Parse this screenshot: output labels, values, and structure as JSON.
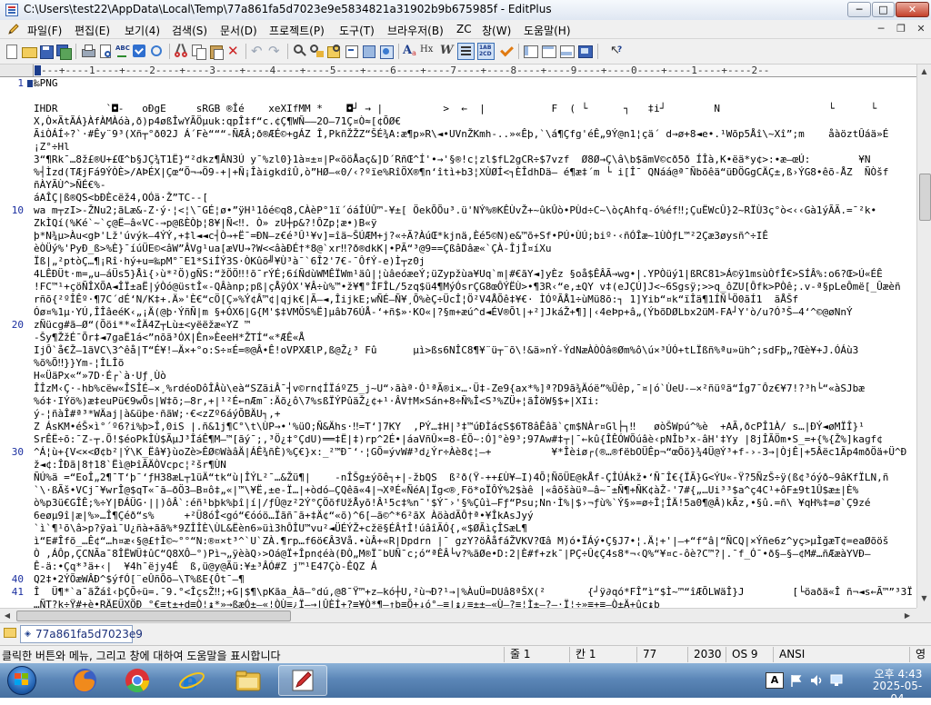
{
  "window": {
    "title": "C:\\Users\\test22\\AppData\\Local\\Temp\\77a861fa5d7023e9e5834821a31902b9b675985f - EditPlus",
    "min_label": "─",
    "max_label": "□",
    "close_label": "✕"
  },
  "menu": {
    "items": [
      "파일(F)",
      "편집(E)",
      "보기(4)",
      "검색(S)",
      "문서(D)",
      "프로젝트(P)",
      "도구(T)",
      "브라우저(B)",
      "ZC",
      "창(W)",
      "도움말(H)"
    ],
    "mdi_min": "─",
    "mdi_restore": "❐",
    "mdi_close": "✕"
  },
  "ruler": {
    "text": "---+----1----+----2----+----3----+----4----+----5----+----6----+----7----+----8----+----9----+----0----+----1----+----2--"
  },
  "editor": {
    "lines": [
      {
        "num": "1",
        "text": "‰PNG"
      },
      {
        "num": "",
        "text": ""
      },
      {
        "num": "",
        "text": "IHDR        `◘-   oÐgE     sRGB ®Îé    xeXIfMM *    ◘┘ → |          >  ←  |           F  ( └      ┐   ‡i┘        N                  └      └"
      },
      {
        "num": "",
        "text": "X,Ò×ÃtÃÁ}ÀfÀMÀóà,ð)p4øßÎwYÃÖµuk:qpÎ‡f“c.¢Ç¶WÑ——2O—71Ç¤Ò≈[¢ÕØ€"
      },
      {
        "num": "",
        "text": "ÃiÒÁÍ÷?`·#Êy¨9³(Xñ┬°ð02J Á´Fè“““-ÑÆÂ;ð®ÆÉ©+gÁZ Î,PkñŽŽZ“ŠÉ¾A:æ¶p»R\\◄•UVnŽKmh-..»«Êþ,`\\á¶Çfg'éÊ„9Ý@n1¦çä´ d→ø+8◄e•.¹Wõp5Åî\\~Xî”;m    åàöztÛáä»É"
      },
      {
        "num": "",
        "text": "¡Z°÷Hl"
      },
      {
        "num": "",
        "text": "3“¶Rk¯…8ž£®U+£Œ^b§JÇ¾T1Ë}“²dkz¶ÂN3Ú y¯%zl0}1à¤±¤|P«õöÅaç&]D´RñŒ^Í'•→'§®!c¦zl$fL2gCR÷$7vzf  Ø8Ø→Ç\\â\\b$ãmV©cð5ð ÍÎà‚K•ëä*y¢>:∙æ—œÚ:        ¥N"
      },
      {
        "num": "",
        "text": "%┤Ìzd(TÆjFá9ÝÒÈ>/AÞÉX|Çœ“Õ¬→Ö9-+|+Ñ¡ÎàigkdîÛ,ò”HØ—«0/‹?ºïe%RîÖX®¶n‘îtì+b3¦XÙØÍ<┐ÈÎdhDä— é¶æ‡´m └ i[Î¯ QNáá@ª¯Ñbõêä“üÐÖGgCÄÇ±,ß›ÝG8•êõ-ÅZ  ÑÒšf"
      },
      {
        "num": "",
        "text": "ñÀYÃÙ^>ÑÉ€%-"
      },
      {
        "num": "",
        "text": "áAÎÇ|ß®QS<bÐÈcëž4,OÓä·Ž”TC--["
      },
      {
        "num": "10",
        "text": "wa m┬zI>-ŽNu2;ãLæ&-Z·ý·¦<¦\\¯GÉ¦ø•”ÿH¹1ôé©q8,CÀèP°1ï´óáÎÚÛ™-¥±[ ÖekÕÕu³.ü'NÝ%®KÊÙvŽ+~ûkÛò•PÙd÷C~\\òçAhfq-ó%éf‼;ÇuËWcÛ}2~RÏÙ3ç°ò<‹‹Gà1ýÃÃ.=¯²k•"
      },
      {
        "num": "",
        "text": "ZkÌQí(%Ké`~`ç@Ë—â«VC-→p@ßÈÒþ¦8¥|Ñ<‼. Ò» zU┼p&?!ÔZp¦æ•)B«ÿ"
      },
      {
        "num": "",
        "text": "þ*N¾µ>Àu<gÞ'Lž'úvýk—4ÝÝ,+‡l◄◄c┤Ò→+Ë¯=ÐN—z€é³Û¹¥v]=îä~ŠÚÆM+j?«÷Ã?ÀúŒ*kjnä,Èé5©N)e&™õ+Sf•PÚ•ÙÚ;biº·‹ñÓÎæ~1ÙÒƒL™²2Çæ3øysñ^÷IÊ"
      },
      {
        "num": "",
        "text": "èÒÜý%'PyÐ_ß>%È}¯íúÜE©<âW”ÂVg¹ua[æVU→?W<<âàÐÉ†*8@`xr‼?ð®dkK|•PÃ“³@9==ÇßâDâæ«`ÇÀ-ÎjÎ¤íXu"
      },
      {
        "num": "",
        "text": "Ïß|„²ptòÇ…¶¡Rî·hý+u=‰pM°¯E1*SiÍÝ3S·ÒKûõ╝¥Ù³à¯`6Î2'7€-¯ÔfÝ-e)Ì┬z0j"
      },
      {
        "num": "",
        "text": "4LÊÐÜt·m=„u—áÜs5}Åì{›ù*²Ö)gÑS:“žÖÖ‼!õ¯rÝÉ;6íÑdùWMÊÏWm¹äû|¦ùâeóæeÝ;üZypžùa¥Uq`m|#€ãY◄]yÈz §oå$ÊÂÃ→wg•|.YPÒüý1|ßRC81>Á©ÿ1msùÒfÎ€>SÍÂ%:o6?Œ>Ú«ÉÊ"
      },
      {
        "num": "",
        "text": "!FC™¹+çöÑÎXÕA◄ÎÏ±aË|ýÒó@üstÎ«-QÂànp;pß|çÅÿÓX'¥Â÷ù%™•ž¥¶°ÎFÎL/5zq$ü4¶MýÓsrÇG8œÔÝËÙ>•¶3R‹“e,±QY v‡(eJÇÚ]J<~6Sgsÿ;>>q_ôZU[Ôfk>PÒê;.v-ª§pLeÔmë[_Ûæèñ"
      },
      {
        "num": "",
        "text": "rñõ{²ºÎÊº·¶7C´dÉ‘N/K‡+.Ä»'È€“cÖ[Ç»%Ý¢Â™¢|qjk€|Ã—◄,ÎijkE;wÑÉ—Ñ¥¸Õ%èÇ÷ÜcÎ¦Ö²V4ÅÕê‡¥€· ÌÓºÃÅ1÷ùMü8õ:┐ 1]Yib“¤k“ïÎä¶1ÍÑ└Ö0ãÍ1  ãÅŠf"
      },
      {
        "num": "",
        "text": "Óø¤%1µ·YÚ,ÎÎâeéK‹„¡Ä(@þ·ÝñÑ|m §+ÓX6|G{M'$‡VMÖS%Ë]µâb76ÚÅ-‘+ñ$»·KO«|?§m+æú^d◄ÉV®Õl|+²]JkáŽ+¶]|‹4eÞp+â„(ÝbõDØLbx2üM-FA┘Y'ò/u?Ó³Š—4‘^©@øNnÝ"
      },
      {
        "num": "20",
        "text": "zÑücg#ã—Ø“(Õöi**«ÎÄ4Z┬Lù±<yëëžæ«YZ ™"
      },
      {
        "num": "",
        "text": "-Šy¶ŽžÉ¯Õr‡◄7gaË1á<”nõã³ÓX|Ên»ÈeeH*ŽTÍ“«*ÆÊ«Å"
      },
      {
        "num": "",
        "text": "IjÔ`å€Ž–1ãVC\\3^êå|T“É¥!—Ä×+°o:S÷¤É=®@Â•Ê!oVPXÆlP,ß@Ž¿³ Fû      µì>ßs6NÎC8¶¥¨ü┬¨õ\\!&ä»nÝ-ÝdNæÀÒÒâ®Øm%ô\\ú×³ÚÓ+tLÏßñ%ªu»üh^;sdFþ„?Œè¥+J.ÓÁù3"
      },
      {
        "num": "",
        "text": "%õ%Õ‼}}Ym-¦ÎLÎõ"
      },
      {
        "num": "",
        "text": "H«ÜäPx«“»7D·É┌`à·Uƒ¸Ùò"
      },
      {
        "num": "",
        "text": "ÎÎzM‹Ç·-hb%cëw«ÎSÎÉ—×¸%rdéoDôÎÂù\\eà“SZãiÂ¯┤v©rn¢ÍÏáºZ5_j~U“›ãàª·Ó¹ªÃ®i×…·Ü‡-Ze9{ax*%]ª?D9ã¾Äóë”%Üêp,¯¤|ó`ÙeU-—×²ñüºã“Íg7¯Ôz€¥7!?³h└“«àSJbæ"
      },
      {
        "num": "",
        "text": "%ó‡·IÝö%)æ‡euPü€9wÕs|W‡õ;—8r‚+|¹²É←nÆm¯:Äõ¿ô\\7%sßÏÝPûäŽ¿¢+¹·ÂV†M×Sán+8÷Ñ%Î<S³%ZÜ+¦ãÎöW§$+|XIi:"
      },
      {
        "num": "",
        "text": "ý-¦ñàÎ#ª³*WÄaj|à&üþe·ñãW;·€<zZº6áýÕBÄU┐,+"
      },
      {
        "num": "",
        "text": "Z ÁsKM•éŠ×ì°´º6?i%þ>Î,0iS |.ñ&1j¶C°\\t\\ÙP→•'%üO;Ñ&Ähs·‼=T‘]7KY  ,PÝ…‡H|³‡™úÐÌá¢S$6T8âÊâã`çm$NÀr¤Gl├┐‼   øòŠWpú^%è  +AÃ,ðcPÎ1À/ s…|ÐÝ◄øMÏÎ}¹"
      },
      {
        "num": "",
        "text": "SrÊË÷õ:¯Z-┬.Õ!$éoPkÎÙ$ÃµJ³ÎáÊ¶M—™[ãý¯;,³Ö¿‡°ÇdU)══‡Ë|‡)rp^2É•|áaVñÛ×=8-ÉÕ~:Ó]°è9³;97Aw#‡┬|¯←kû{ÎÊÓWÕúâè‹pNÎb³x-âH'‡Yy |8jÎÃÖm•S_=+{%{Ž%]kaɡf¢"
      },
      {
        "num": "30",
        "text": "^Á¦ù+{V<×<Ø¢b²|Ý\\K_Ëâ¥}ùoZè>ÊØ©WàâÄ|ÁÊ¾ñÈ)%Ç€}x:_²™Ð¯‘·¦GÕ=ývW#³d¿Ýr÷Àè8¢¦—+          ¥*Îèiø┌(®…®fëbOÜÊp¬“œÕö}¾4Ü@Ý³+f-›-3→|ÒjÊ|+5Âëc1Ãp4mðÖä+Ü^Ð"
      },
      {
        "num": "",
        "text": "ž◄¢:ÎÐã|8†18`Ëì@ÞîÃÄÒVcpc¦²šr¶ÙN"
      },
      {
        "num": "",
        "text": "ÑÚ%ä =“EoÎ„2¶¯T‘þ¯‘ƒH38æL┬1üÄ“tk“ù|ÎÝL²¯…&Žü¶|    -nÎŠg±ýõê┐+|-žbQS  ß²ð(Ÿ-++£Ù¥—I)4Õ¦ÑõÜE@kÅf-ÇÎÚÁkž•‘Ñ¯Î€{ÏÃ}G<ÝU«-Ÿ?5ÑzŠ÷ÿ(ß¢³óýð~9âKfÏLN,ñ"
      },
      {
        "num": "",
        "text": "`\\·ßÃš•VCj¯¥wrÎ@$qT«¯ã—ðÖ3—B¤ô‡„«|™\\¥Ë,±e-Ï…|+òdó—ÇQêã«4|¬XªÉ«ÑéA|Ïg<®¸Fö*oÏÔÝ%2$àê |«âõšàüª—â~¯±Ñ¶+ÑK¢àŽ-'7#{„…Ui³³$a^ç4C¹+ôF±9t1Û$æ±|È%"
      },
      {
        "num": "",
        "text": "ò%p3ü€GÎÊ;%÷Y|ÐÁÜG·||)ôÂ`:éñ¹bþk%þî|í|/ƒÛ@z²2Ý°ÇÖõfUžÅyõ!Â¹5c‡%n¯'$Ý¯›'§%Çûì—Fƒ“Psu;Nn·Ì%|$›¬ƒù%`Ý§»=ø÷Î¦ÎÄ!5a0¶@Â)kÃz,•§û.=ñ\\ ¥qH%‡=ø`Ç9zé"
      },
      {
        "num": "",
        "text": "6eøµ9î|æ|%»…Î¶Çéð“s%     +²Ü8óÎ<gó“€óóö…Ïãñ¯ã+‡Ä¢“«õ)^6[—ã©^*6²ãX ÀöàdÃÔ†ª•¥ÎkAsJyý"
      },
      {
        "num": "",
        "text": "`ì`¶¹õ\\â>p?ÿaì¯U¿ñà+ãã%*9ZÎÎÈ\\ÙL&Ëèn6»üì3hÔÎU™vu²◄ÜÉÝŽ+cžë§ÉÂ†Î!úâîÃÓ{,«$ØÃìçÎSæL¶"
      },
      {
        "num": "",
        "text": "ì“E#Îfõ_…Ê¢“…h¤æ‹§@£†Ì©~°°“N:®¤×t³^`U`ZÀ.¶rp…f6ö€Â3Vå.•ùÂ+«R|Dpdrn |¯ gzY?öÂåfáŽVKV?Œâ M)ó•ÏÁý•Ç§J7•¦.Ä¦+'|—+“f“â|“ÑCQ|×Ýñe6z^yç>µÌgæT¢=eaØõöš"
      },
      {
        "num": "",
        "text": "Ò ,ÁÔp,ÇCNÃa¯8ÎËWÜ‡ûC“Q8XÔ—°)Pì¬„ÿèàQ›>Oá@Ï+Îpn¢éà(ÐÒ„M®Ϊ¯bUÑ¯c;ó“ªÊÂ└v?%ãØe•D:2|È#f+zk¯|PÇ÷Û¢Ç4s8*¬‹Q%“¥¤c-ôè?C™?|.¯f_Ó¯•ð§—§—¢M#…ñÆæàYVÐ—"
      },
      {
        "num": "",
        "text": "Ê-ä:•Çq*³ä+‹|  ¥4h¯ëjy4É  ß,ü@y@Ãü:¥±³ÂÓ#Z j™¹E47Çò-ÊQZ Á"
      },
      {
        "num": "40",
        "text": "Q2‡•2ÝÕæWÂÐ^$ýfÓ[¨eÛñÕõ—\\T%ßE{Ôt¯—¶"
      },
      {
        "num": "41",
        "text": "Î  Ü¶*`a¯ãŽáî‹þÇÕ÷ü=.¯9.°<ÎçsŽ‼;+G|$¶\\pKãa_Àã—°dú,@8¯Ÿ™+z—kó┼U,²ù¬Ð?¹→|%ÀuÜ=DUâ8ªŠX(²       {┘ÿ∂qó*FÎ”ì“$Ì~™“îÆÕLWäÎ}J        [└öaðä«Î ñ¬◄s←Ã™”³3Ï"
      },
      {
        "num": "",
        "text": "…ÑT?k÷Ÿ#+è•RÄEÜXÖÐ °€≡t±+d≡Ò¦↨*»→ßæÓ±—«¦ÒÙ≡¿Ï—→|ÛÈÍ+?≡¥Ò*¶—↑b≡Õ+↓ó°—≡|↨¿≡±±—«Ù—?≡¦Ì±—?—·Ï¦÷»≡+≡—Ò±Ä+ûc↨þ"
      }
    ]
  },
  "tabs": {
    "doc_label": "77a861fa5d7023e9"
  },
  "status": {
    "message": "클릭한 버튼와 메뉴, 그리고 창에 대하여 도움말을 표시합니다",
    "line": "줄 1",
    "col": "칸 1",
    "chars": "77",
    "size": "2030",
    "format": "OS 9",
    "encoding": "ANSI",
    "ime": "영"
  },
  "taskbar": {
    "apps": [
      "windows-start",
      "firefox",
      "chrome",
      "internet-explorer",
      "file-explorer",
      "editplus"
    ],
    "clock_time": "오후 4:43",
    "clock_date": "2025-05-04",
    "tray_lang": "A"
  },
  "colors": {
    "accent": "#1c3d8c",
    "link_text": "#1a3fbd",
    "line_numbers": "#1b2fa0"
  }
}
